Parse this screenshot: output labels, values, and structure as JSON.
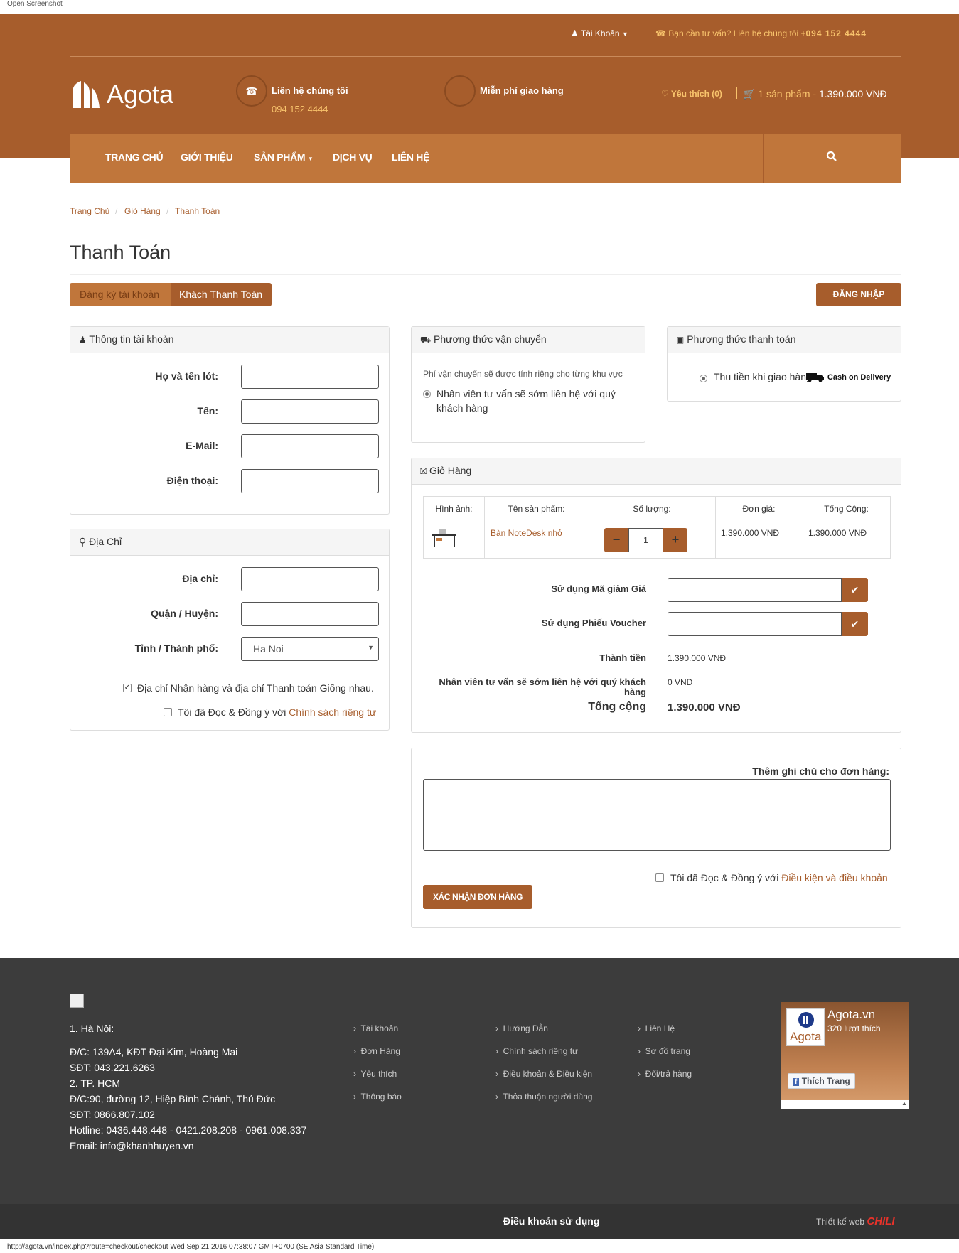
{
  "browser": {
    "title": "Open Screenshot",
    "status": "http://agota.vn/index.php?route=checkout/checkout Wed Sep 21 2016 07:38:07 GMT+0700 (SE Asia Standard Time)"
  },
  "topbar": {
    "account": "Tài Khoản",
    "consult": "Bạn cần tư vấn? Liên hệ chúng tôi +",
    "phone": "094 152 4444"
  },
  "brand": {
    "name": "Agota"
  },
  "contact": {
    "title": "Liên hệ chúng tôi",
    "phone": "094 152 4444"
  },
  "shipping_promo": {
    "title": "Miễn phí giao hàng"
  },
  "wishlist": "Yêu thích (0)",
  "cart_summary": {
    "count": "1 sản phẩm - ",
    "total": "1.390.000 VNĐ"
  },
  "nav": {
    "items": [
      "TRANG CHỦ",
      "GIỚI THIỆU",
      "SẢN PHẨM",
      "DỊCH VỤ",
      "LIÊN HỆ"
    ]
  },
  "breadcrumb": [
    "Trang Chủ",
    "Giỏ Hàng",
    "Thanh Toán"
  ],
  "page_title": "Thanh Toán",
  "tabs": {
    "register": "Đăng ký tài khoản",
    "guest": "Khách Thanh Toán"
  },
  "login_button": "ĐĂNG NHẬP",
  "account_panel": {
    "title": "Thông tin tài khoản",
    "fields": [
      "Họ và tên lót:",
      "Tên:",
      "E-Mail:",
      "Điện thoại:"
    ]
  },
  "address_panel": {
    "title": "Địa Chỉ",
    "fields": [
      "Địa chỉ:",
      "Quận / Huyện:",
      "Tỉnh / Thành phố:"
    ],
    "city_value": "Ha Noi",
    "same_address": "Địa chỉ Nhận hàng và địa chỉ Thanh toán Giống nhau.",
    "agree_prefix": "Tôi đã Đọc & Đồng ý với ",
    "agree_link": "Chính sách riêng tư"
  },
  "shipping_panel": {
    "title": "Phương thức vận chuyển",
    "note": "Phí vận chuyển sẽ được tính riêng cho từng khu vực",
    "option": "Nhân viên tư vấn sẽ sớm liên hệ với quý khách hàng"
  },
  "payment_panel": {
    "title": "Phương thức thanh toán",
    "option": "Thu tiền khi giao hàng",
    "cod_label": "Cash on Delivery"
  },
  "cart_panel": {
    "title": "Giỏ Hàng",
    "headers": [
      "Hình ảnh:",
      "Tên sản phẩm:",
      "Số lượng:",
      "Đơn giá:",
      "Tổng Cộng:"
    ],
    "product": {
      "name": "Bàn NoteDesk nhỏ",
      "qty": "1",
      "price": "1.390.000 VNĐ",
      "total": "1.390.000 VNĐ"
    },
    "coupon_label": "Sử dụng Mã giảm Giá",
    "voucher_label": "Sử dụng Phiếu Voucher",
    "subtotal_label": "Thành tiền",
    "subtotal_value": "1.390.000 VNĐ",
    "shipping_label": "Nhân viên tư vấn sẽ sớm liên hệ với quý khách hàng",
    "shipping_value": "0 VNĐ",
    "total_label": "Tổng cộng",
    "total_value": "1.390.000 VNĐ"
  },
  "notes": {
    "label": "Thêm ghi chú cho đơn hàng:",
    "agree_prefix": "Tôi đã Đọc & Đồng ý với ",
    "agree_link": "Điều kiện và điều khoản",
    "confirm": "XÁC NHẬN ĐƠN HÀNG"
  },
  "footer": {
    "address": [
      "1. Hà Nội:",
      "Đ/C: 139A4, KĐT Đại Kim, Hoàng Mai",
      "SĐT: 043.221.6263",
      "2. TP. HCM",
      "Đ/C:90, đường 12, Hiệp Bình Chánh, Thủ Đức",
      "SĐT: 0866.807.102",
      "Hotline: 0436.448.448 - 0421.208.208 - 0961.008.337",
      "Email: info@khanhhuyen.vn"
    ],
    "col1": [
      "Tài khoản",
      "Đơn Hàng",
      "Yêu thích",
      "Thông báo"
    ],
    "col2": [
      "Hướng Dẫn",
      "Chính sách riêng tư",
      "Điều khoản & Điều kiện",
      "Thỏa thuận người dùng"
    ],
    "col3": [
      "Liên Hệ",
      "Sơ đồ trang",
      "Đổi/trả hàng"
    ],
    "fb": {
      "name": "Agota.vn",
      "likes": "320 lượt thích",
      "logo": "Agota",
      "like_btn": "Thích Trang"
    },
    "terms": "Điều khoản sử dụng",
    "design_prefix": "Thiết kế web",
    "design_brand": "CHILI"
  },
  "colors": {
    "brand": "#a75d2c",
    "nav": "#c0763b",
    "footer": "#3c3c3c",
    "highlight": "#f8c36c"
  }
}
